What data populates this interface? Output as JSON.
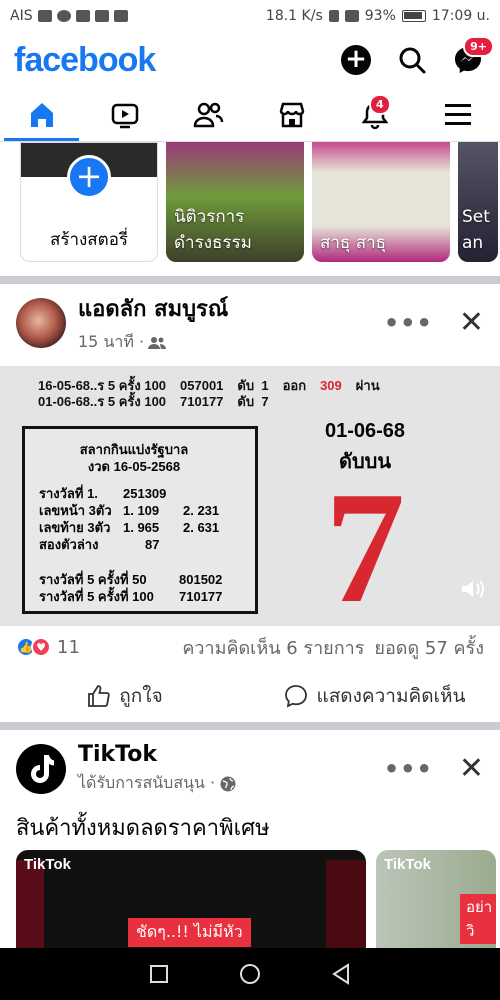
{
  "status_bar": {
    "carrier": "AIS",
    "network_speed": "18.1 K/s",
    "battery": "93%",
    "time": "17:09 u."
  },
  "header": {
    "logo": "facebook",
    "messenger_badge": "9+",
    "brand_color": "#1877f2"
  },
  "nav": {
    "notifications_badge": "4",
    "items": [
      "home-icon",
      "video-icon",
      "friends-icon",
      "marketplace-icon",
      "bell-icon",
      "menu-icon"
    ]
  },
  "stories": {
    "create_label": "สร้างสตอรี่",
    "items": [
      {
        "label": "นิติวรการ ดำรงธรรม"
      },
      {
        "label": "สาธุ สาธุ"
      },
      {
        "label": "Set an"
      }
    ]
  },
  "post1": {
    "author": "แอดลัก สมบูรณ์",
    "time": "15 นาที ·",
    "image": {
      "line1_date": "16-05-68..ร 5 ครั้ง 100",
      "line1_num": "057001",
      "line1_rank": "ดับ  1",
      "line1_out": "ออก",
      "line1_hl": "309",
      "line1_pass": "ผ่าน",
      "line2_date": "01-06-68..ร 5 ครั้ง 100",
      "line2_num": "710177",
      "line2_rank": "ดับ  7",
      "box_title1": "สลากกินแบ่งรัฐบาล",
      "box_title2": "งวด 16-05-2568",
      "rows": [
        {
          "a": "รางวัลที่ 1.",
          "b": "251309",
          "c": ""
        },
        {
          "a": "เลขหน้า 3ตัว",
          "b": "1.  109",
          "c": "2. 231"
        },
        {
          "a": "เลขท้าย 3ตัว",
          "b": "1.  965",
          "c": "2. 631"
        },
        {
          "a": "สองตัวล่าง",
          "b": "87",
          "c": ""
        }
      ],
      "rows2": [
        {
          "a": "รางวัลที่ 5 ครั้งที่  50",
          "b": "801502"
        },
        {
          "a": "รางวัลที่ 5 ครั้งที่ 100",
          "b": "710177"
        }
      ],
      "right_date": "01-06-68",
      "right_sub": "ดับบน",
      "big_number": "7"
    },
    "reaction_count": "11",
    "comments": "ความคิดเห็น 6 รายการ",
    "views": "ยอดดู 57 ครั้ง",
    "like_label": "ถูกใจ",
    "comment_label": "แสดงความคิดเห็น"
  },
  "post2": {
    "author": "TikTok",
    "sponsored": "ได้รับการสนับสนุน ·",
    "text": "สินค้าทั้งหมดลดราคาพิเศษ",
    "ad1_logo": "TikTok",
    "ad1_tag": "ชัดๆ..!! ไม่มีหัว",
    "ad2_logo": "TikTok",
    "ad2_tag": "อย่าวิ"
  }
}
